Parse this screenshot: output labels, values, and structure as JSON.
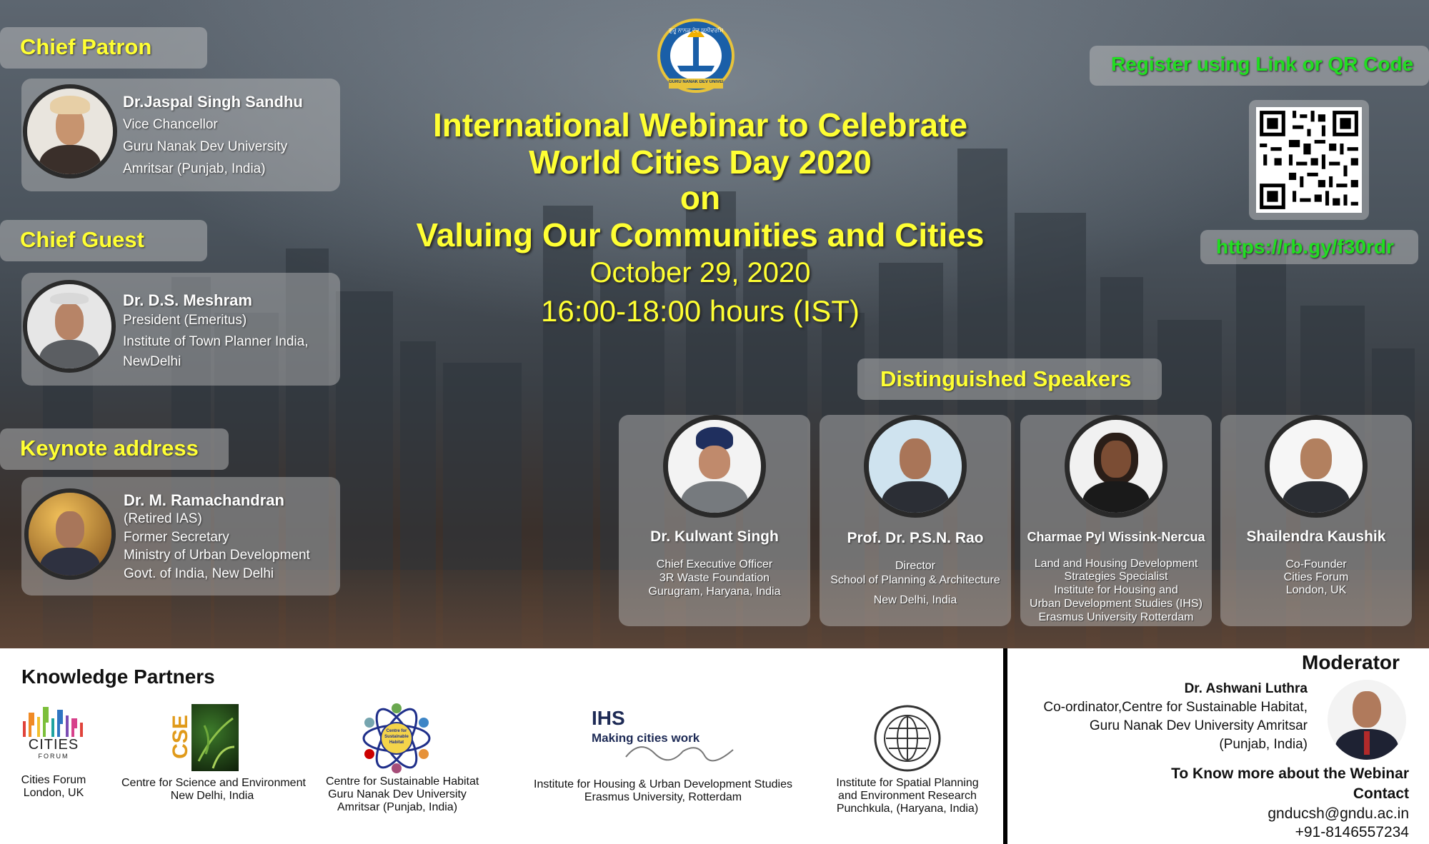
{
  "chief_patron": {
    "heading": "Chief Patron",
    "name": "Dr.Jaspal Singh Sandhu",
    "lines": [
      "Vice Chancellor",
      "Guru Nanak Dev University",
      "Amritsar (Punjab, India)"
    ]
  },
  "chief_guest": {
    "heading": "Chief Guest",
    "name": "Dr. D.S. Meshram",
    "lines": [
      "President (Emeritus)",
      "Institute of Town Planner India,",
      "NewDelhi"
    ]
  },
  "keynote": {
    "heading": "Keynote address",
    "name": "Dr. M. Ramachandran",
    "lines": [
      "(Retired IAS)",
      "Former Secretary",
      "Ministry of Urban Development",
      "Govt. of India, New Delhi"
    ]
  },
  "logo": {
    "arc_text": "ਗੁਰੂ ਨਾਨਕ ਦੇਵ ਯੂਨੀਵਰਸਿਟੀ",
    "banner_text": "GURU NANAK DEV UNIVERSITY"
  },
  "title": {
    "line1": "International Webinar to Celebrate",
    "line2": "World Cities Day 2020",
    "line3": "on",
    "line4": "Valuing Our Communities and Cities",
    "date": "October 29, 2020",
    "time": "16:00-18:00 hours (IST)"
  },
  "register": {
    "label": "Register using Link or QR Code",
    "link": "https://rb.gy/f30rdr"
  },
  "speakers": {
    "heading": "Distinguished Speakers",
    "items": [
      {
        "name": "Dr. Kulwant Singh",
        "lines": [
          "Chief Executive Officer",
          "3R Waste Foundation",
          "Gurugram, Haryana, India"
        ]
      },
      {
        "name": "Prof. Dr. P.S.N. Rao",
        "lines": [
          "Director",
          "School of Planning & Architecture",
          "New Delhi, India"
        ]
      },
      {
        "name": "Charmae Pyl Wissink-Nercua",
        "lines": [
          "Land and Housing Development",
          "Strategies Specialist",
          "Institute for Housing and",
          "Urban Development Studies (IHS)",
          "Erasmus University Rotterdam"
        ]
      },
      {
        "name": "Shailendra Kaushik",
        "lines": [
          "Co-Founder",
          "Cities Forum",
          "London, UK"
        ]
      }
    ]
  },
  "partners": {
    "heading": "Knowledge Partners",
    "cities_logo": "CITIES",
    "cities_logo_sub": "FORUM",
    "cse_logo": "CSE",
    "csh_logo": "Centre for Sustainable Habitat",
    "ihs_logo": "IHS",
    "ihs_tagline": "Making cities work",
    "items": [
      {
        "lines": [
          "Cities Forum",
          "London, UK"
        ]
      },
      {
        "lines": [
          "Centre for Science and Environment",
          "New Delhi, India"
        ]
      },
      {
        "lines": [
          "Centre for Sustainable Habitat",
          "Guru Nanak Dev University",
          "Amritsar (Punjab, India)"
        ]
      },
      {
        "lines": [
          "Institute for Housing & Urban Development Studies",
          "Erasmus University, Rotterdam"
        ]
      },
      {
        "lines": [
          "Institute for Spatial Planning",
          "and Environment Research",
          "Punchkula, (Haryana, India)"
        ]
      }
    ]
  },
  "moderator": {
    "heading": "Moderator",
    "name": "Dr. Ashwani Luthra",
    "lines": [
      "Co-ordinator,Centre for Sustainable Habitat,",
      "Guru Nanak Dev University Amritsar",
      "(Punjab, India)"
    ]
  },
  "contact": {
    "line1": "To Know more about the Webinar",
    "heading": "Contact",
    "email": "gnducsh@gndu.ac.in",
    "phone": "+91-8146557234"
  }
}
